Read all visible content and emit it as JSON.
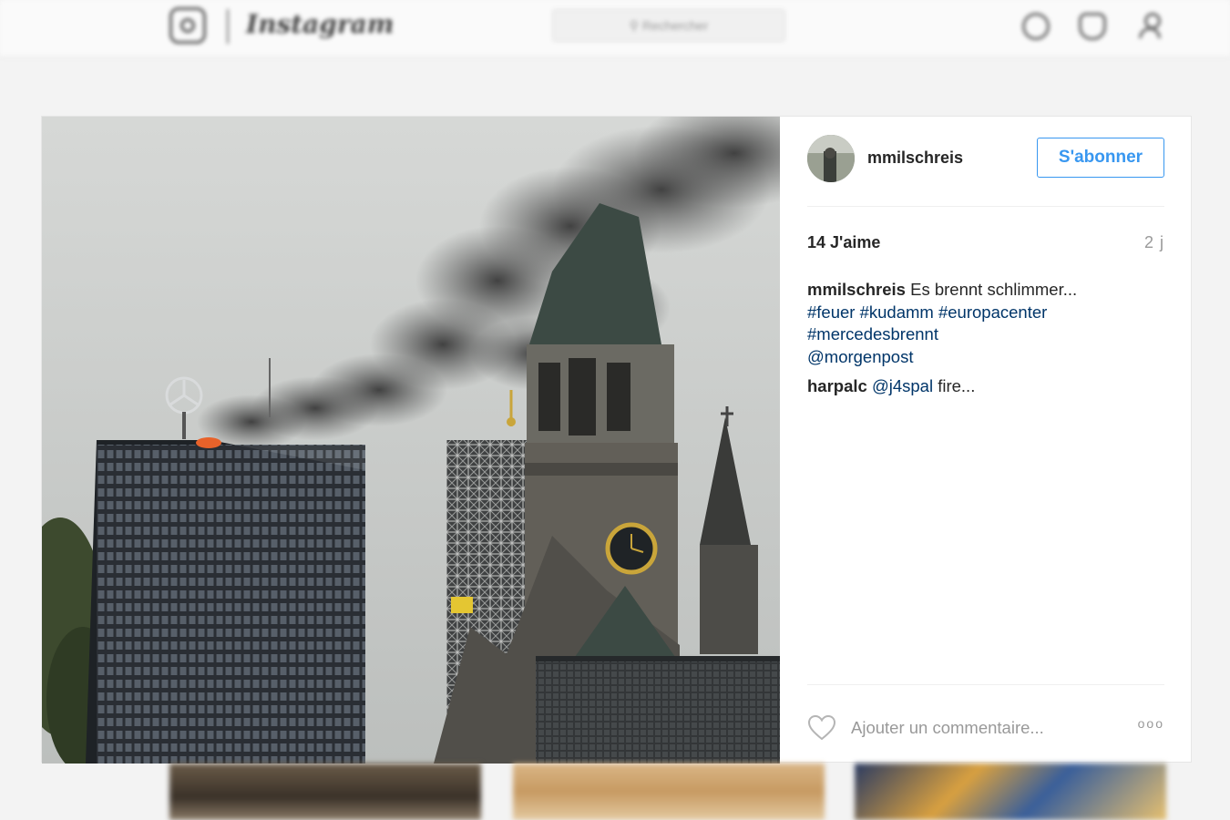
{
  "nav": {
    "logo_icon": "instagram-camera-icon",
    "logo_text": "Instagram",
    "search_placeholder": "Rechercher",
    "icons": [
      "compass-icon",
      "heart-icon",
      "profile-icon"
    ]
  },
  "post": {
    "username": "mmilschreis",
    "follow_label": "S'abonner",
    "likes": "14 J'aime",
    "time": "2 j",
    "caption": {
      "username": "mmilschreis",
      "text": "Es brennt schlimmer...",
      "hashtags": [
        "#feuer",
        "#kudamm",
        "#europacenter",
        "#mercedesbrennt"
      ],
      "mention": "@morgenpost"
    },
    "comments": [
      {
        "username": "harpalc",
        "mention": "@j4spal",
        "text": "fire..."
      }
    ],
    "comment_placeholder": "Ajouter un commentaire...",
    "more_label": "ooo"
  },
  "colors": {
    "accent": "#3897f0",
    "link": "#003569",
    "muted": "#999999",
    "text": "#262626"
  }
}
